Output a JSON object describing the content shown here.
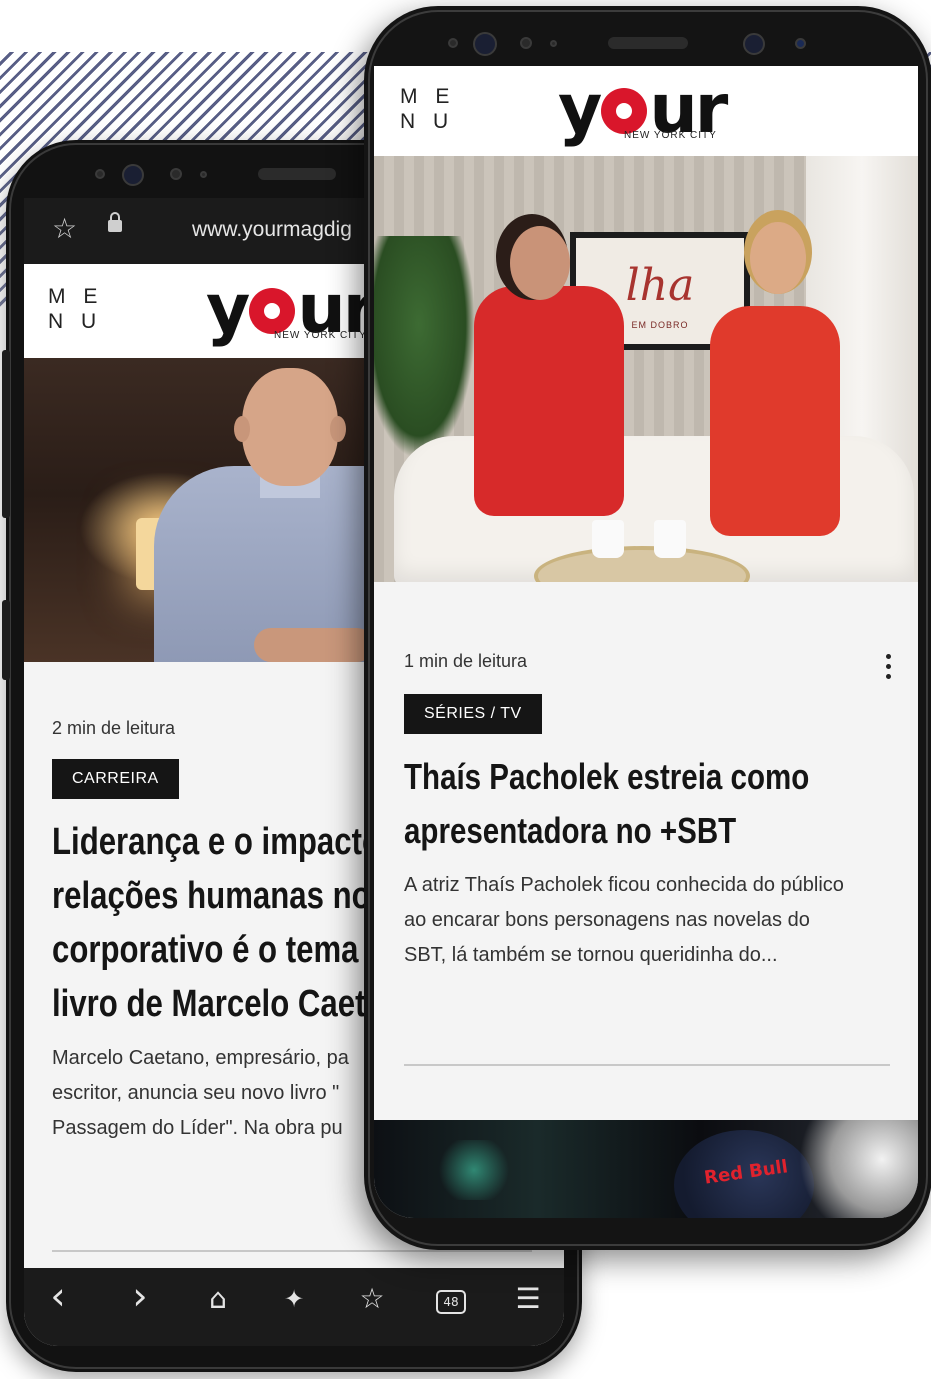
{
  "back_phone": {
    "browser": {
      "url": "www.yourmagdig"
    },
    "header": {
      "menu_line1": "M E",
      "menu_line2": "N U",
      "logo_left": "y",
      "logo_right": "ur",
      "logo_sub": "NEW YORK CITY"
    },
    "article": {
      "read_time": "2 min de leitura",
      "category": "CARREIRA",
      "headline_lines": [
        "Liderança e o impacto",
        "relações humanas no",
        "corporativo é o tema",
        "livro de Marcelo Caeta"
      ],
      "excerpt_lines": [
        "Marcelo Caetano, empresário, pa",
        "escritor, anuncia seu novo livro \"",
        "Passagem do Líder\". Na obra pu"
      ]
    },
    "bottom_nav": {
      "back_icon": "‹",
      "forward_icon": "›",
      "home_icon": "⌂",
      "ai_icon": "✦",
      "bookmarks_icon": "☆",
      "tabs_count": "48",
      "menu_icon": "☰"
    }
  },
  "front_phone": {
    "header": {
      "menu_line1": "M E",
      "menu_line2": "N U",
      "logo_left": "y",
      "logo_right": "ur",
      "logo_sub": "NEW YORK CITY"
    },
    "photo": {
      "tv_logo": "lha",
      "tv_sub": "EM DOBRO"
    },
    "article": {
      "read_time": "1 min de leitura",
      "category": "SÉRIES / TV",
      "headline_lines": [
        "Thaís Pacholek estreia como",
        "apresentadora no +SBT"
      ],
      "excerpt_lines": [
        "A atriz Thaís Pacholek ficou conhecida do público",
        "ao encarar bons personagens nas novelas do",
        "SBT, lá também se tornou queridinha do..."
      ]
    },
    "teaser": {
      "brand_text": "Red Bull"
    }
  },
  "colors": {
    "accent_red": "#d9162b",
    "dark": "#151515",
    "screen_bg": "#f4f4f4"
  }
}
